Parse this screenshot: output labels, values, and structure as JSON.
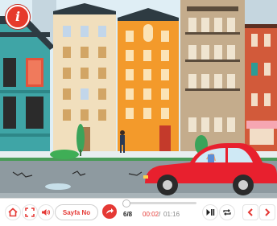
{
  "scene": {
    "name": "city-street-animation"
  },
  "info_button": {
    "label": "i"
  },
  "controls": {
    "page_label": "Sayfa No",
    "page_counter": "6/8",
    "time_current": "00:02",
    "time_separator": "/",
    "time_total": "01:16",
    "progress_fraction": 0.03,
    "icons": [
      "home-icon",
      "fullscreen-icon",
      "volume-icon",
      "go-arrow-icon",
      "play-pause-icon",
      "repeat-icon",
      "previous-icon",
      "next-icon"
    ]
  },
  "colors": {
    "accent": "#e53935",
    "sky": "#dfeef5",
    "road": "#8e9aa0",
    "car": "#e8202e"
  }
}
